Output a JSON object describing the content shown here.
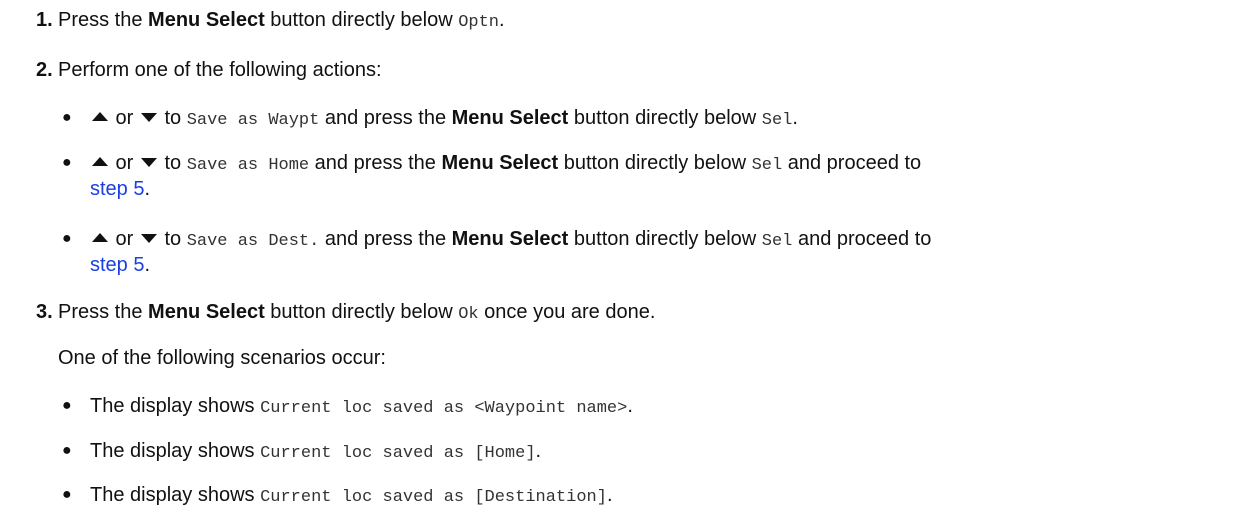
{
  "step1": {
    "number": "1.",
    "t1": "Press the ",
    "menu_select": "Menu Select",
    "t2": " button directly below ",
    "code": "Optn",
    "end": "."
  },
  "step2": {
    "number": "2.",
    "text": "Perform one of the following actions:",
    "options": [
      {
        "or": " or ",
        "to": " to ",
        "code": "Save as Waypt",
        "t1": " and press the ",
        "menu_select": "Menu Select",
        "t2": " button directly below ",
        "code2": "Sel",
        "end": "."
      },
      {
        "or": " or ",
        "to": " to ",
        "code": "Save as Home",
        "t1": " and press the ",
        "menu_select": "Menu Select",
        "t2": " button directly below ",
        "code2": "Sel",
        "t3": " and proceed to",
        "link": "step 5",
        "end": "."
      },
      {
        "or": " or ",
        "to": " to ",
        "code": "Save as Dest.",
        "t1": " and press the ",
        "menu_select": "Menu Select",
        "t2": " button directly below ",
        "code2": "Sel",
        "t3": " and proceed to",
        "link": "step 5",
        "end": "."
      }
    ]
  },
  "step3": {
    "number": "3.",
    "t1": "Press the ",
    "menu_select": "Menu Select",
    "t2": " button directly below ",
    "code": "Ok",
    "t3": " once you are done.",
    "scenario_intro": "One of the following scenarios occur:",
    "scenarios": [
      {
        "prefix": "The display shows ",
        "code": "Current loc saved as <Waypoint name>",
        "end": "."
      },
      {
        "prefix": "The display shows ",
        "code": "Current loc saved as [Home]",
        "end": "."
      },
      {
        "prefix": "The display shows ",
        "code": "Current loc saved as [Destination]",
        "end": "."
      }
    ]
  },
  "icons": {
    "up": "up-arrow-icon",
    "down": "down-arrow-icon"
  },
  "colors": {
    "link": "#1a3fe0",
    "text": "#111111"
  }
}
